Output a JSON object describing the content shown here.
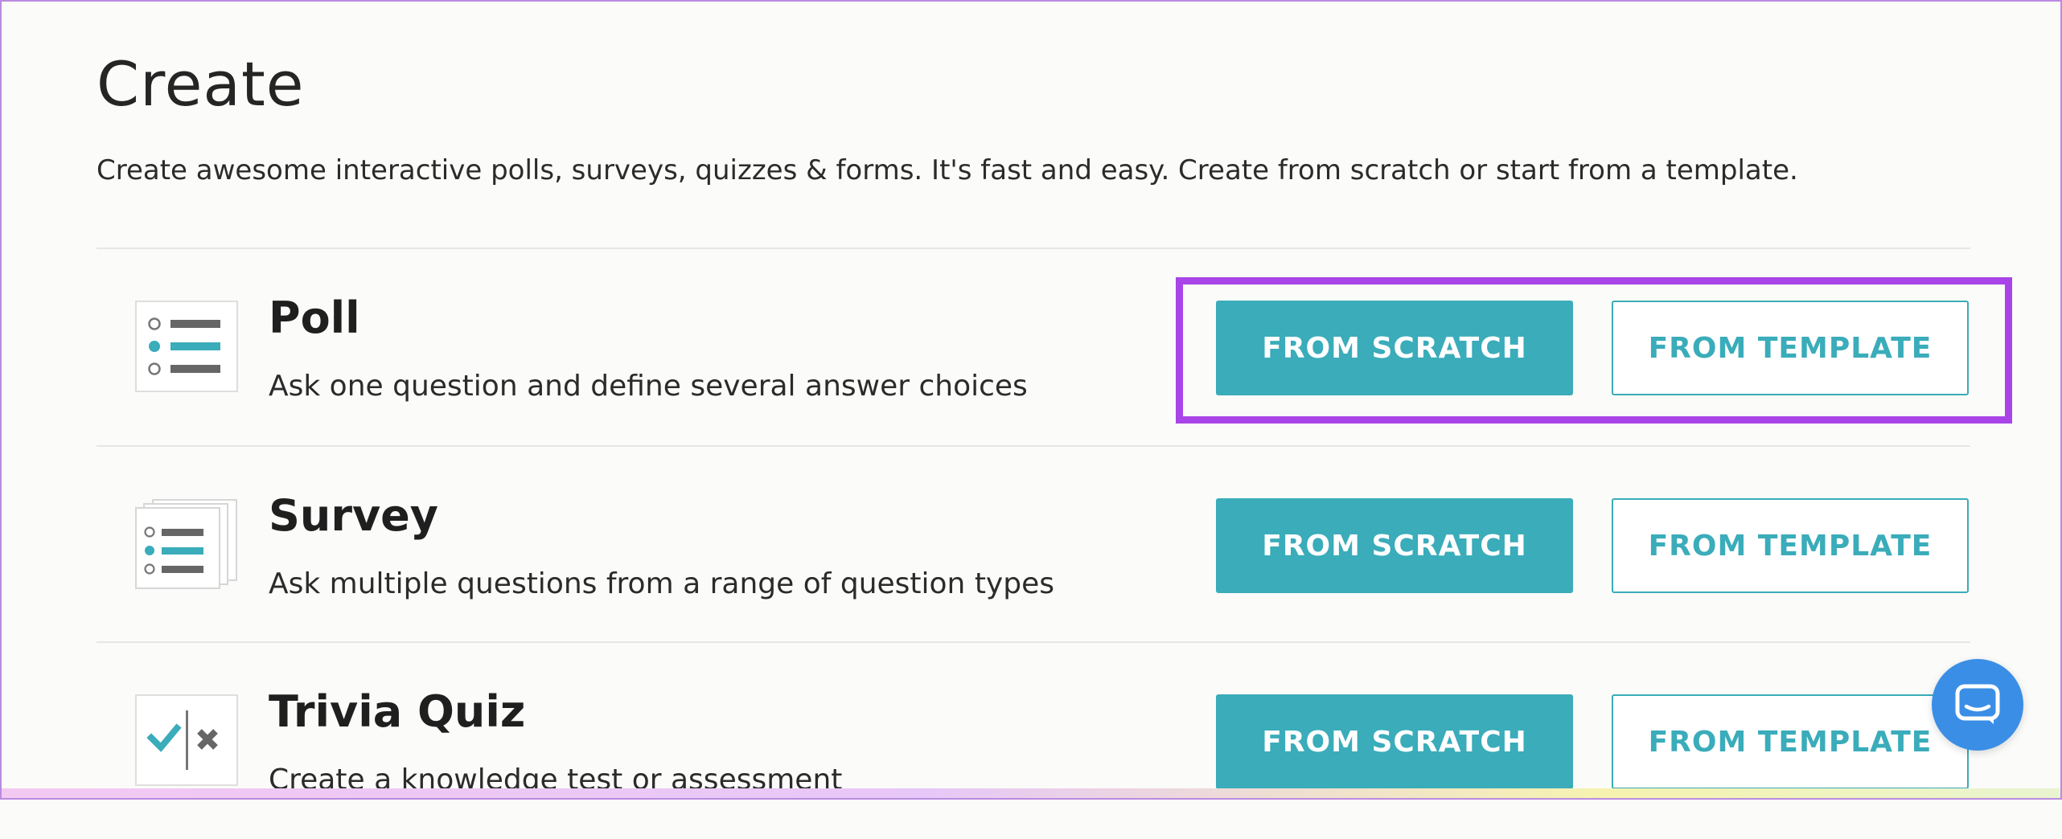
{
  "page": {
    "title": "Create",
    "subtitle": "Create awesome interactive polls, surveys, quizzes & forms. It's fast and easy. Create from scratch or start from a template."
  },
  "rows": [
    {
      "title": "Poll",
      "description": "Ask one question and define several answer choices",
      "scratch_label": "FROM SCRATCH",
      "template_label": "FROM TEMPLATE",
      "icon": "poll-icon"
    },
    {
      "title": "Survey",
      "description": "Ask multiple questions from a range of question types",
      "scratch_label": "FROM SCRATCH",
      "template_label": "FROM TEMPLATE",
      "icon": "survey-icon"
    },
    {
      "title": "Trivia Quiz",
      "description": "Create a knowledge test or assessment",
      "scratch_label": "FROM SCRATCH",
      "template_label": "FROM TEMPLATE",
      "icon": "trivia-quiz-icon"
    }
  ],
  "chat": {
    "icon": "chat-icon"
  },
  "colors": {
    "accent": "#3aacba",
    "highlight": "#a944e8",
    "chat_bubble": "#3b8ee6",
    "background": "#fbfbf9"
  }
}
